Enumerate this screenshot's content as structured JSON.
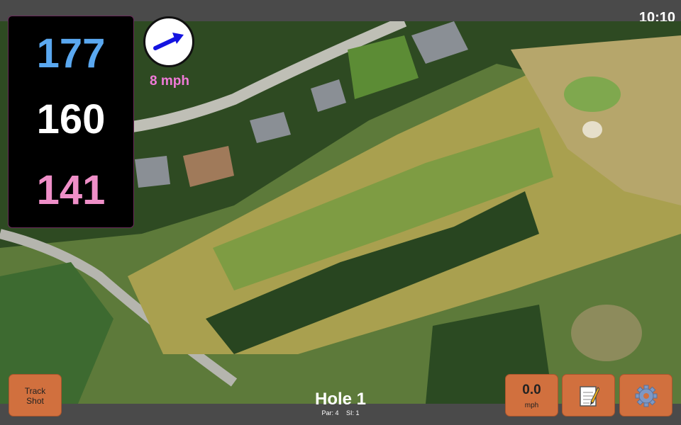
{
  "status_bar": {
    "clock": "10:10"
  },
  "distances": {
    "back": "177",
    "middle": "160",
    "front": "141"
  },
  "wind": {
    "speed_label": "8 mph",
    "direction": "east-northeast",
    "icon": "wind-arrow-icon"
  },
  "hole": {
    "title": "Hole 1",
    "par": "Par: 4",
    "si": "SI: 1"
  },
  "buttons": {
    "track_shot_line1": "Track",
    "track_shot_line2": "Shot",
    "wind_value": "0.0",
    "wind_unit": "mph",
    "notes_icon": "notepad-icon",
    "settings_icon": "gear-icon"
  },
  "colors": {
    "back_distance": "#5aa8f0",
    "middle_distance": "#ffffff",
    "front_distance": "#ef8fc8",
    "wind_text": "#f07ad8",
    "button": "#d1703e"
  }
}
